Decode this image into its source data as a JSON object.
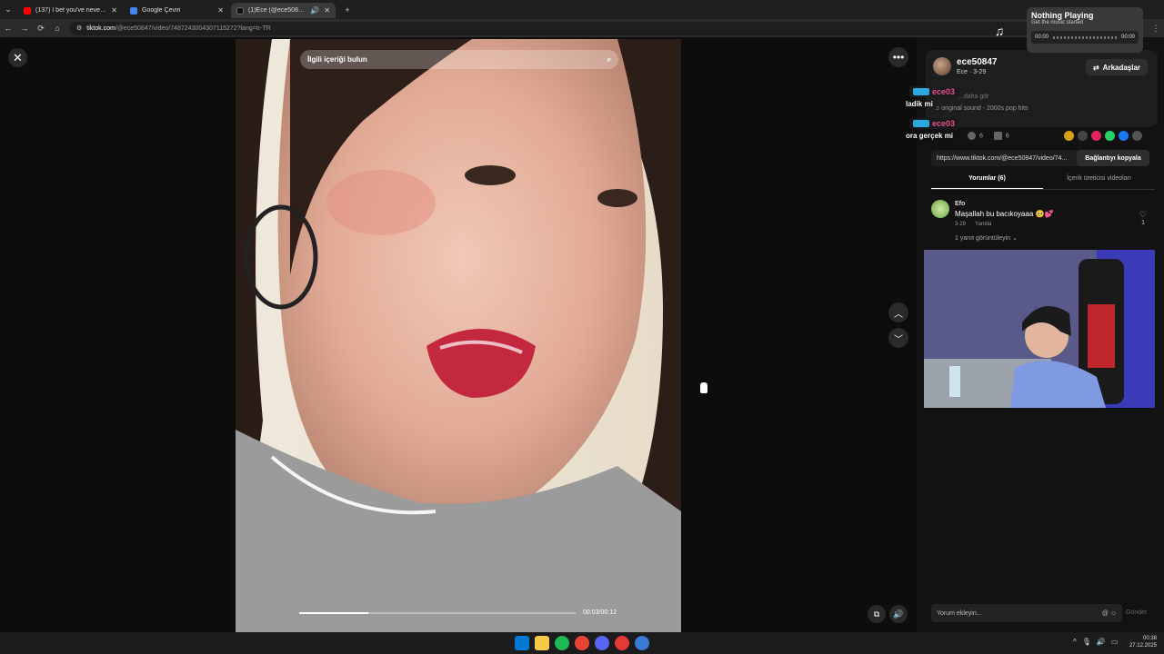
{
  "browser": {
    "tabs": [
      {
        "title": "(137) I bet you've never seen s...",
        "favicon_color": "#ff0000",
        "active": false
      },
      {
        "title": "Google Çeviri",
        "favicon_color": "#4285f4",
        "active": false
      },
      {
        "title": "(1)Ece (@ece50847) | TikTok",
        "favicon_color": "#111111",
        "active": true
      }
    ],
    "url_host": "tiktok.com",
    "url_path": "/@ece50847/video/7487243004307115272?lang=tr-TR"
  },
  "video": {
    "search_placeholder": "İlgili içeriği bulun",
    "time": "00:03/00:12",
    "progress": 0.25
  },
  "profile": {
    "username": "ece50847",
    "subtitle": "Ece · 3-29",
    "friends_button": "Arkadaşlar",
    "hint": "...daha gör",
    "sound": "original sound - 2000s pop hits",
    "comment_count": "6",
    "save_count": "6"
  },
  "chat": [
    {
      "user": "ece03",
      "message": "ladik mi"
    },
    {
      "user": "ece03",
      "message": "ora gerçek mi"
    }
  ],
  "share": {
    "link": "https://www.tiktok.com/@ece50847/video/74...",
    "copy_button": "Bağlantıyı kopyala",
    "colors": [
      "#d4a017",
      "#444444",
      "#e0245e",
      "#25d366",
      "#1877f2",
      "#555555"
    ]
  },
  "tabs": {
    "comments": "Yorumlar (6)",
    "creator_videos": "İçerik üreticisi videoları"
  },
  "comment": {
    "author": "Efo",
    "text": "Maşallah bu bacıkoyaaa 🥺💕",
    "date": "3-29",
    "reply": "Yanıtla",
    "likes": "1",
    "view_replies": "1 yanıt görüntüleyin"
  },
  "comment_input": {
    "placeholder": "Yorum ekleyin...",
    "send": "Gönder"
  },
  "mini_player": {
    "title": "Nothing Playing",
    "subtitle": "Get the music started",
    "time_start": "00:00",
    "time_end": "00:00"
  },
  "taskbar": {
    "time": "00:38",
    "date": "27.12.2025",
    "icon_colors": [
      "#0078d4",
      "#f7c948",
      "#1db954",
      "#ea4335",
      "#5865f2",
      "#e53935",
      "#3a7bd5"
    ]
  }
}
